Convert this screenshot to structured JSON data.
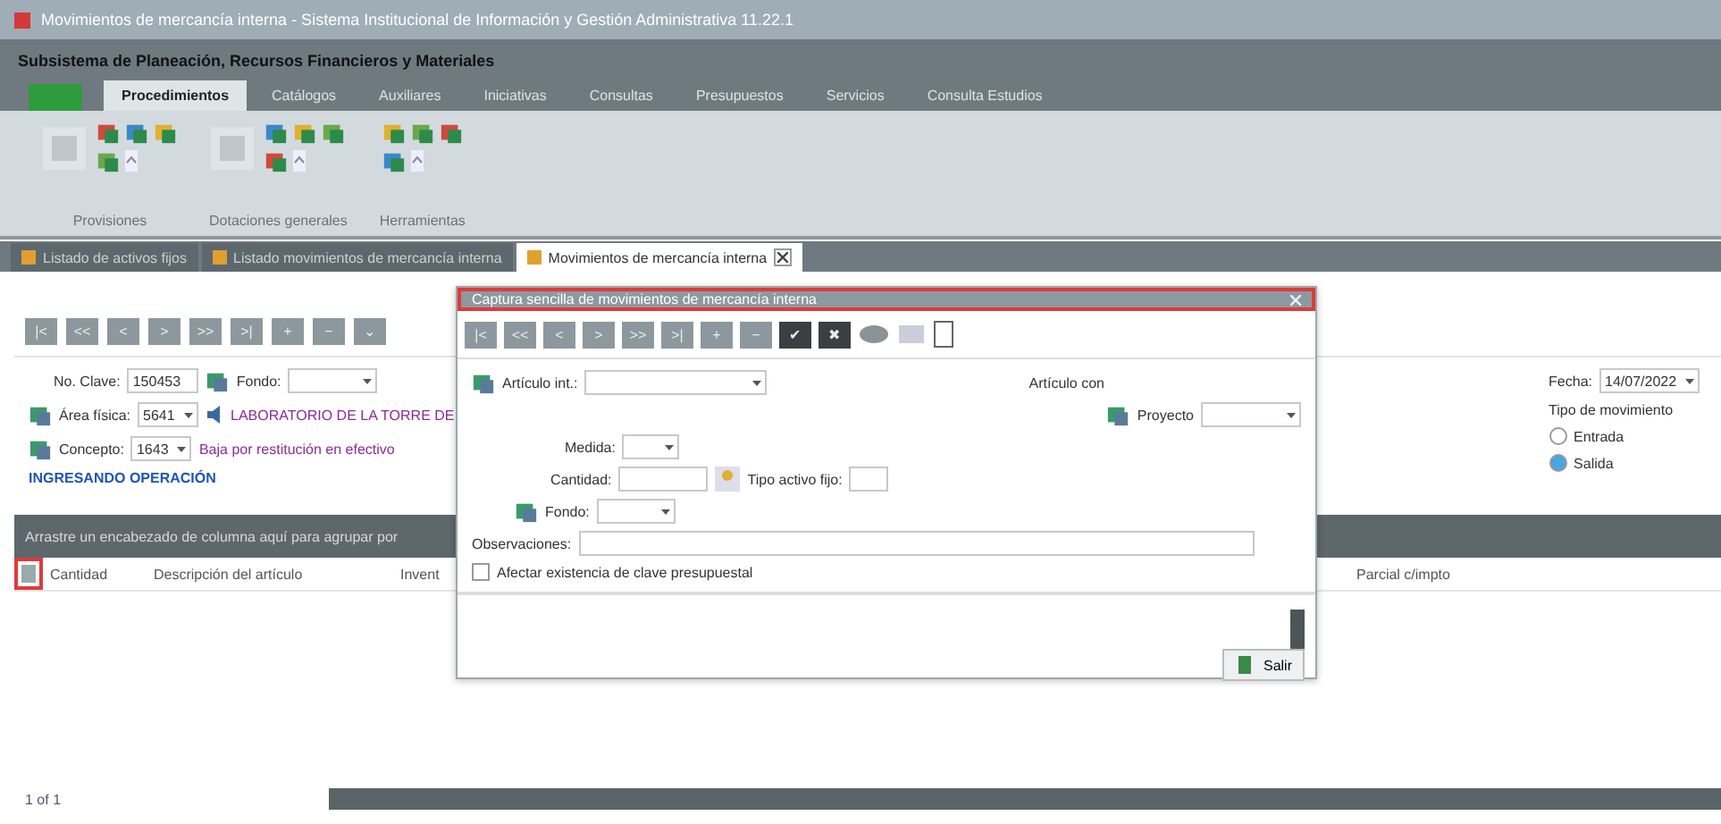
{
  "window": {
    "title": "Movimientos de mercancía interna - Sistema Institucional de Información y Gestión Administrativa 11.22.1"
  },
  "app_bar": {
    "title": "Subsistema de Planeación, Recursos Financieros y Materiales"
  },
  "ribbon": {
    "tabs": [
      {
        "label": "Procedimientos",
        "selected": true
      },
      {
        "label": "Catálogos",
        "selected": false
      },
      {
        "label": "Auxiliares",
        "selected": false
      },
      {
        "label": "Iniciativas",
        "selected": false
      },
      {
        "label": "Consultas",
        "selected": false
      },
      {
        "label": "Presupuestos",
        "selected": false
      },
      {
        "label": "Servicios",
        "selected": false
      },
      {
        "label": "Consulta Estudios",
        "selected": false
      }
    ],
    "groups": [
      {
        "label": "Provisiones",
        "kind": "large"
      },
      {
        "label": "Dotaciones generales",
        "kind": "large"
      },
      {
        "label": "Herramientas",
        "kind": "small"
      }
    ]
  },
  "document_tabs": [
    {
      "label": "Listado de activos fijos",
      "selected": false,
      "closable": false
    },
    {
      "label": "Listado movimientos de mercancía interna",
      "selected": false,
      "closable": false
    },
    {
      "label": "Movimientos de mercancía interna",
      "selected": true,
      "closable": true
    }
  ],
  "toolbar": {
    "buttons": [
      "|<",
      "<<",
      "<",
      ">",
      ">>",
      ">|",
      "+",
      "−",
      "⌄"
    ]
  },
  "form": {
    "clave_label": "No. Clave:",
    "clave": "150453",
    "fondo_label": "Fondo:",
    "area_label": "Área física:",
    "area": "5641",
    "area_name": "LABORATORIO DE LA TORRE DE",
    "concepto_label": "Concepto:",
    "concepto": "1643",
    "concepto_name": "Baja por restitución en efectivo",
    "status": "INGRESANDO OPERACIÓN",
    "fecha_label": "Fecha:",
    "fecha": "14/07/2022",
    "tipo_label": "Tipo de movimiento",
    "tipos": [
      {
        "label": "Entrada",
        "selected": false
      },
      {
        "label": "Salida",
        "selected": true
      }
    ]
  },
  "grid": {
    "group_hint": "Arrastre un encabezado de columna aquí para agrupar por",
    "columns": [
      "Cantidad",
      "Descripción del artículo",
      "Invent",
      "Parcial c/impto"
    ]
  },
  "pager": {
    "text": "1 of 1"
  },
  "dialog": {
    "title": "Captura sencilla de movimientos de mercancía interna",
    "toolbar": [
      "|<",
      "<<",
      "<",
      ">",
      ">>",
      ">|",
      "+",
      "−",
      "✔",
      "✖"
    ],
    "articulo_label": "Artículo int.:",
    "articulo_con_label": "Artículo con",
    "proyecto_label": "Proyecto",
    "medida_label": "Medida:",
    "cantidad_label": "Cantidad:",
    "tipo_label": "Tipo activo fijo:",
    "fondo_label": "Fondo:",
    "observaciones_label": "Observaciones:",
    "afectar": {
      "label": "Afectar existencia de clave presupuestal",
      "checked": false
    },
    "close_button": "Salir"
  }
}
